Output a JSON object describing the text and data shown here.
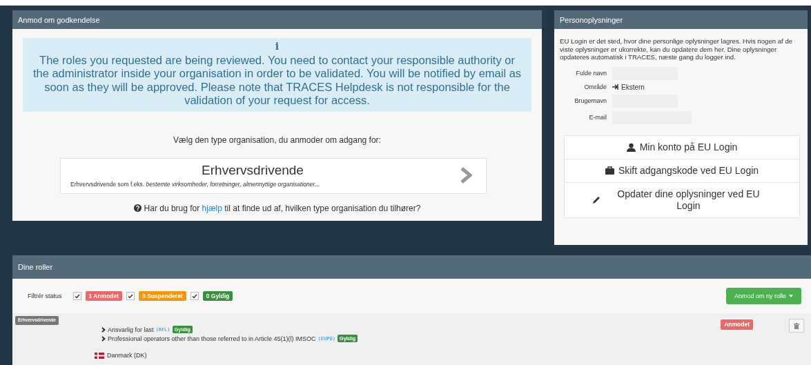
{
  "request_panel": {
    "title": "Anmod om godkendelse",
    "info_icon": "i",
    "info_text": "The roles you requested are being reviewed. You need to contact your responsible authority or the administrator inside your organisation in order to be validated. You will be notified by email as soon as they will be approved. Please note that TRACES Helpdesk is not responsible for the validation of your request for access.",
    "prompt": "Vælg den type organisation, du anmoder om adgang for:",
    "org_card": {
      "title": "Erhvervsdrivende",
      "description": "Erhvervsdrivende som f.eks. *bestemte virksomheder, forretninger, almennyttige organisationer...*"
    },
    "help_before": "Har du brug for ",
    "help_link": "hjælp",
    "help_after": " til at finde ud af, hvilken type organisation du tilhører?"
  },
  "personal_panel": {
    "title": "Personoplysninger",
    "intro": "EU Login er det sted, hvor dine personlige oplysninger lagres. Hvis nogen af de viste oplysninger er ukorrekte, kan du opdatere dem her. Dine oplysninger opdateres automatisk i TRACES, næste gang du logger ind.",
    "fields": [
      {
        "label": "Fulde navn",
        "kind": "blank"
      },
      {
        "label": "Område",
        "kind": "text",
        "value": "Ekstern"
      },
      {
        "label": "Brugernavn",
        "kind": "blank"
      },
      {
        "label": "E-mail",
        "kind": "blank"
      }
    ],
    "links": [
      {
        "label": "Min konto på EU Login",
        "kind": "account"
      },
      {
        "label": "Skift adgangskode ved EU Login",
        "kind": "password"
      },
      {
        "label": "Opdater dine oplysninger ved EU Login",
        "kind": "update"
      }
    ]
  },
  "roles_panel": {
    "title": "Dine roller",
    "filter_label": "Filtrér status",
    "filters": [
      {
        "label": "1 Anmodet",
        "checked": true,
        "color": "#e9686a"
      },
      {
        "label": "0 Suspenderet",
        "checked": true,
        "color": "#f0960f"
      },
      {
        "label": "0 Gyldig",
        "checked": true,
        "color": "#3e8e41"
      }
    ],
    "new_role_button": "Anmod om ny rolle",
    "role": {
      "org_tag": "Erhvervsdrivende",
      "status": "Anmodet",
      "lines": [
        {
          "name": "Ansvarlig for last",
          "code": "(RFL)",
          "badge": "Gyldig"
        },
        {
          "name": "Professional operators other than those referred to in Article 45(1)(l) IMSOC",
          "code": "(EUPO)",
          "badge": "Gyldig"
        }
      ],
      "country": "Danmark (DK)"
    }
  }
}
